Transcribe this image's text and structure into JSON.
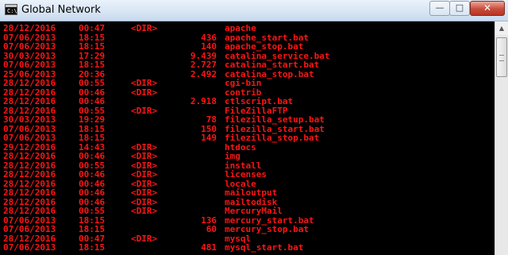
{
  "window": {
    "title": "Global Network",
    "icon": "console-icon",
    "icon_glyph": "C:\\",
    "minimize_glyph": "—",
    "maximize_glyph": "□",
    "close_glyph": "✕"
  },
  "scrollbar": {
    "up_glyph": "▲"
  },
  "colors": {
    "console_text": "#ff1414",
    "console_bg": "#000000"
  },
  "listing": [
    {
      "date": "28/12/2016",
      "time": "00:47",
      "dir": "<DIR>",
      "size": "",
      "name": "apache"
    },
    {
      "date": "07/06/2013",
      "time": "18:15",
      "dir": "",
      "size": "436",
      "name": "apache_start.bat"
    },
    {
      "date": "07/06/2013",
      "time": "18:15",
      "dir": "",
      "size": "140",
      "name": "apache_stop.bat"
    },
    {
      "date": "30/03/2013",
      "time": "17:29",
      "dir": "",
      "size": "9.439",
      "name": "catalina_service.bat"
    },
    {
      "date": "07/06/2013",
      "time": "18:15",
      "dir": "",
      "size": "2.727",
      "name": "catalina_start.bat"
    },
    {
      "date": "25/06/2013",
      "time": "20:36",
      "dir": "",
      "size": "2.492",
      "name": "catalina_stop.bat"
    },
    {
      "date": "28/12/2016",
      "time": "00:55",
      "dir": "<DIR>",
      "size": "",
      "name": "cgi-bin"
    },
    {
      "date": "28/12/2016",
      "time": "00:46",
      "dir": "<DIR>",
      "size": "",
      "name": "contrib"
    },
    {
      "date": "28/12/2016",
      "time": "00:46",
      "dir": "",
      "size": "2.918",
      "name": "ctlscript.bat"
    },
    {
      "date": "28/12/2016",
      "time": "00:55",
      "dir": "<DIR>",
      "size": "",
      "name": "FileZillaFTP"
    },
    {
      "date": "30/03/2013",
      "time": "19:29",
      "dir": "",
      "size": "78",
      "name": "filezilla_setup.bat"
    },
    {
      "date": "07/06/2013",
      "time": "18:15",
      "dir": "",
      "size": "150",
      "name": "filezilla_start.bat"
    },
    {
      "date": "07/06/2013",
      "time": "18:15",
      "dir": "",
      "size": "149",
      "name": "filezilla_stop.bat"
    },
    {
      "date": "29/12/2016",
      "time": "14:43",
      "dir": "<DIR>",
      "size": "",
      "name": "htdocs"
    },
    {
      "date": "28/12/2016",
      "time": "00:46",
      "dir": "<DIR>",
      "size": "",
      "name": "img"
    },
    {
      "date": "28/12/2016",
      "time": "00:55",
      "dir": "<DIR>",
      "size": "",
      "name": "install"
    },
    {
      "date": "28/12/2016",
      "time": "00:46",
      "dir": "<DIR>",
      "size": "",
      "name": "licenses"
    },
    {
      "date": "28/12/2016",
      "time": "00:46",
      "dir": "<DIR>",
      "size": "",
      "name": "locale"
    },
    {
      "date": "28/12/2016",
      "time": "00:46",
      "dir": "<DIR>",
      "size": "",
      "name": "mailoutput"
    },
    {
      "date": "28/12/2016",
      "time": "00:46",
      "dir": "<DIR>",
      "size": "",
      "name": "mailtodisk"
    },
    {
      "date": "28/12/2016",
      "time": "00:55",
      "dir": "<DIR>",
      "size": "",
      "name": "MercuryMail"
    },
    {
      "date": "07/06/2013",
      "time": "18:15",
      "dir": "",
      "size": "136",
      "name": "mercury_start.bat"
    },
    {
      "date": "07/06/2013",
      "time": "18:15",
      "dir": "",
      "size": "60",
      "name": "mercury_stop.bat"
    },
    {
      "date": "28/12/2016",
      "time": "00:47",
      "dir": "<DIR>",
      "size": "",
      "name": "mysql"
    },
    {
      "date": "07/06/2013",
      "time": "18:15",
      "dir": "",
      "size": "481",
      "name": "mysql_start.bat"
    }
  ]
}
